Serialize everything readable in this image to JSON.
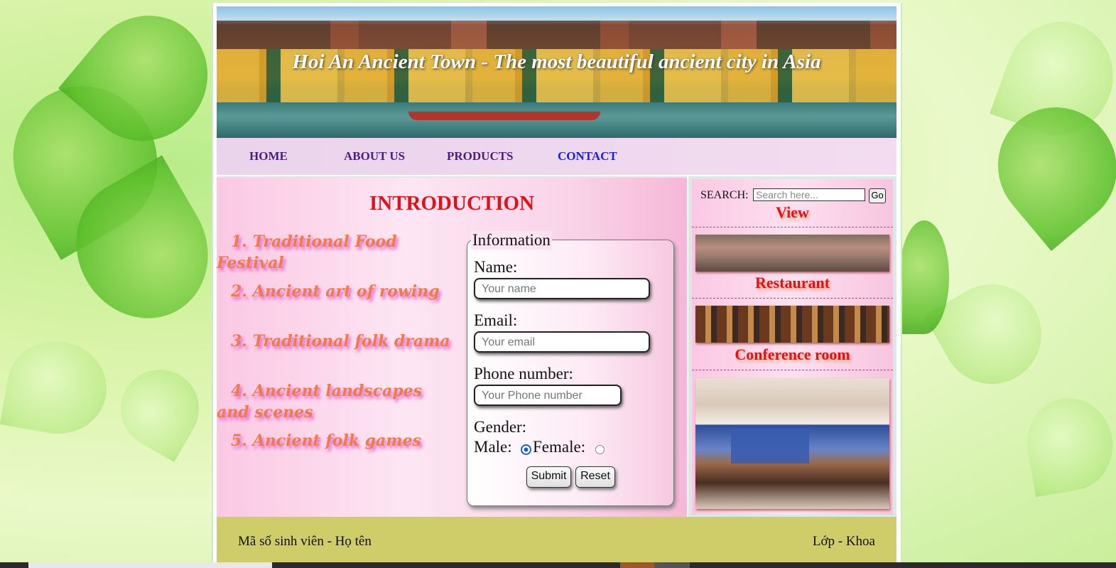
{
  "banner": {
    "title": "Hoi An Ancient Town - The most beautiful ancient city in Asia"
  },
  "nav": {
    "items": [
      {
        "label": "HOME"
      },
      {
        "label": "ABOUT US"
      },
      {
        "label": "PRODUCTS"
      },
      {
        "label": "CONTACT"
      }
    ]
  },
  "intro": {
    "title": "INTRODUCTION",
    "items": [
      "1. Traditional Food Festival",
      "2. Ancient art of rowing",
      "3. Traditional folk drama",
      "4. Ancient landscapes and scenes",
      "5. Ancient folk games"
    ]
  },
  "form": {
    "legend": "Information",
    "name_label": "Name:",
    "name_placeholder": "Your name",
    "email_label": "Email:",
    "email_placeholder": "Your email",
    "phone_label": "Phone number:",
    "phone_placeholder": "Your Phone number",
    "gender_label": "Gender:",
    "male_label": "Male:",
    "female_label": "Female:",
    "gender_selected": "Male",
    "submit_label": "Submit",
    "reset_label": "Reset"
  },
  "sidebar": {
    "search_label": "SEARCH:",
    "search_placeholder": "Search here...",
    "go_label": "Go",
    "captions": [
      "View",
      "Restaurant",
      "Conference room"
    ]
  },
  "footer": {
    "left": "Mã số sinh viên - Họ tên",
    "right": "Lớp - Khoa"
  },
  "colors": {
    "nav_text": "#4d1d7d",
    "nav_active": "#1a20d8",
    "intro_title": "#e1111a",
    "list_text": "#f07a4c",
    "footer_bg": "#cfcd6a"
  }
}
